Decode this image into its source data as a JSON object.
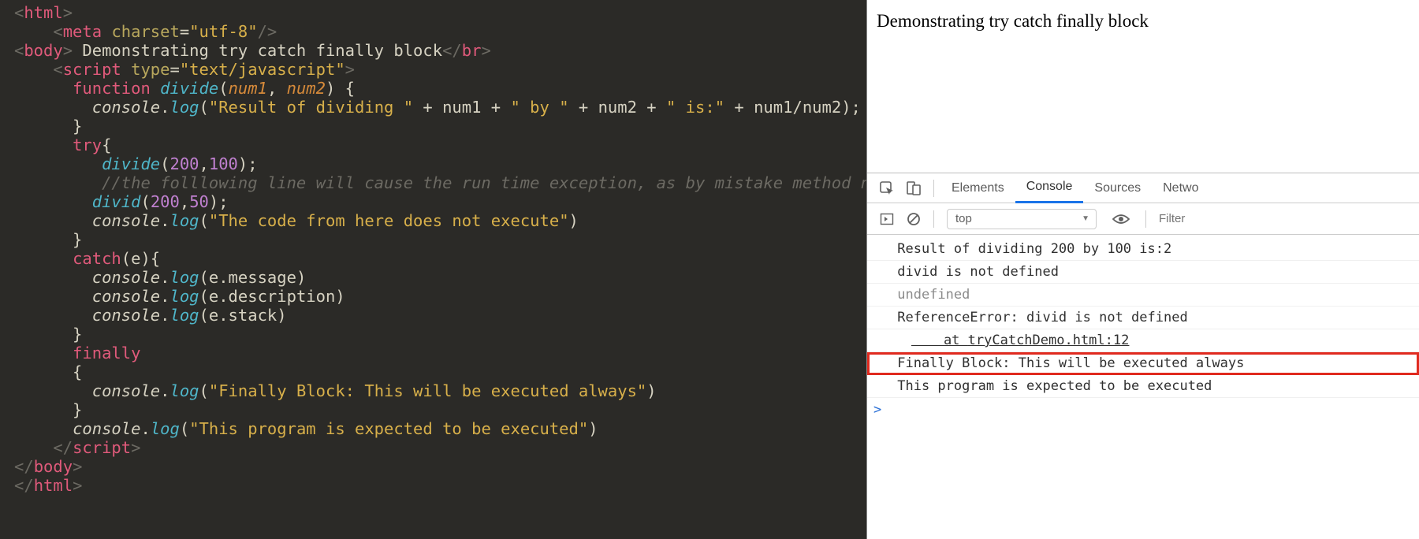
{
  "page": {
    "body_text": "Demonstrating try catch finally block"
  },
  "code": {
    "lines": [
      [
        {
          "t": "sl",
          "v": "<"
        },
        {
          "t": "tag",
          "v": "html"
        },
        {
          "t": "sl",
          "v": ">"
        }
      ],
      [
        {
          "t": "pun",
          "v": "    "
        },
        {
          "t": "sl",
          "v": "<"
        },
        {
          "t": "tag",
          "v": "meta"
        },
        {
          "t": "pun",
          "v": " "
        },
        {
          "t": "attr",
          "v": "charset"
        },
        {
          "t": "pun",
          "v": "="
        },
        {
          "t": "val",
          "v": "\"utf-8\""
        },
        {
          "t": "sl",
          "v": "/>"
        }
      ],
      [
        {
          "t": "sl",
          "v": "<"
        },
        {
          "t": "tag",
          "v": "body"
        },
        {
          "t": "sl",
          "v": "> "
        },
        {
          "t": "txt",
          "v": "Demonstrating try catch finally block"
        },
        {
          "t": "sl",
          "v": "</"
        },
        {
          "t": "tag",
          "v": "br"
        },
        {
          "t": "sl",
          "v": ">"
        }
      ],
      [
        {
          "t": "pun",
          "v": "    "
        },
        {
          "t": "sl",
          "v": "<"
        },
        {
          "t": "tag",
          "v": "script"
        },
        {
          "t": "pun",
          "v": " "
        },
        {
          "t": "attr",
          "v": "type"
        },
        {
          "t": "pun",
          "v": "="
        },
        {
          "t": "val",
          "v": "\"text/javascript\""
        },
        {
          "t": "sl",
          "v": ">"
        }
      ],
      [
        {
          "t": "pun",
          "v": "      "
        },
        {
          "t": "kw",
          "v": "function"
        },
        {
          "t": "pun",
          "v": " "
        },
        {
          "t": "fn",
          "v": "divide"
        },
        {
          "t": "pun",
          "v": "("
        },
        {
          "t": "param",
          "v": "num1"
        },
        {
          "t": "pun",
          "v": ", "
        },
        {
          "t": "param",
          "v": "num2"
        },
        {
          "t": "pun",
          "v": ") {"
        }
      ],
      [
        {
          "t": "pun",
          "v": "        "
        },
        {
          "t": "obj",
          "v": "console"
        },
        {
          "t": "pun",
          "v": "."
        },
        {
          "t": "meth",
          "v": "log"
        },
        {
          "t": "pun",
          "v": "("
        },
        {
          "t": "str",
          "v": "\"Result of dividing \""
        },
        {
          "t": "pun",
          "v": " + "
        },
        {
          "t": "txt",
          "v": "num1"
        },
        {
          "t": "pun",
          "v": " + "
        },
        {
          "t": "str",
          "v": "\" by \""
        },
        {
          "t": "pun",
          "v": " + "
        },
        {
          "t": "txt",
          "v": "num2"
        },
        {
          "t": "pun",
          "v": " + "
        },
        {
          "t": "str",
          "v": "\" is:\""
        },
        {
          "t": "pun",
          "v": " + "
        },
        {
          "t": "txt",
          "v": "num1"
        },
        {
          "t": "pun",
          "v": "/"
        },
        {
          "t": "txt",
          "v": "num2"
        },
        {
          "t": "pun",
          "v": ");"
        }
      ],
      [
        {
          "t": "pun",
          "v": "      }"
        }
      ],
      [
        {
          "t": "pun",
          "v": ""
        }
      ],
      [
        {
          "t": "pun",
          "v": "      "
        },
        {
          "t": "kw",
          "v": "try"
        },
        {
          "t": "pun",
          "v": "{"
        }
      ],
      [
        {
          "t": "pun",
          "v": "         "
        },
        {
          "t": "fn",
          "v": "divide"
        },
        {
          "t": "pun",
          "v": "("
        },
        {
          "t": "num",
          "v": "200"
        },
        {
          "t": "pun",
          "v": ","
        },
        {
          "t": "num",
          "v": "100"
        },
        {
          "t": "pun",
          "v": ");"
        }
      ],
      [
        {
          "t": "pun",
          "v": "         "
        },
        {
          "t": "cmt",
          "v": "//the folllowing line will cause the run time exception, as by mistake method name is wrong"
        }
      ],
      [
        {
          "t": "pun",
          "v": "        "
        },
        {
          "t": "fn",
          "v": "divid"
        },
        {
          "t": "pun",
          "v": "("
        },
        {
          "t": "num",
          "v": "200"
        },
        {
          "t": "pun",
          "v": ","
        },
        {
          "t": "num",
          "v": "50"
        },
        {
          "t": "pun",
          "v": ");"
        }
      ],
      [
        {
          "t": "pun",
          "v": "        "
        },
        {
          "t": "obj",
          "v": "console"
        },
        {
          "t": "pun",
          "v": "."
        },
        {
          "t": "meth",
          "v": "log"
        },
        {
          "t": "pun",
          "v": "("
        },
        {
          "t": "str",
          "v": "\"The code from here does not execute\""
        },
        {
          "t": "pun",
          "v": ")"
        }
      ],
      [
        {
          "t": "pun",
          "v": "      }"
        }
      ],
      [
        {
          "t": "pun",
          "v": "      "
        },
        {
          "t": "kw",
          "v": "catch"
        },
        {
          "t": "pun",
          "v": "(e){"
        }
      ],
      [
        {
          "t": "pun",
          "v": "        "
        },
        {
          "t": "obj",
          "v": "console"
        },
        {
          "t": "pun",
          "v": "."
        },
        {
          "t": "meth",
          "v": "log"
        },
        {
          "t": "pun",
          "v": "(e.message)"
        }
      ],
      [
        {
          "t": "pun",
          "v": "        "
        },
        {
          "t": "obj",
          "v": "console"
        },
        {
          "t": "pun",
          "v": "."
        },
        {
          "t": "meth",
          "v": "log"
        },
        {
          "t": "pun",
          "v": "(e.description)"
        }
      ],
      [
        {
          "t": "pun",
          "v": "        "
        },
        {
          "t": "obj",
          "v": "console"
        },
        {
          "t": "pun",
          "v": "."
        },
        {
          "t": "meth",
          "v": "log"
        },
        {
          "t": "pun",
          "v": "(e.stack)"
        }
      ],
      [
        {
          "t": "pun",
          "v": "      }"
        }
      ],
      [
        {
          "t": "pun",
          "v": "      "
        },
        {
          "t": "kw",
          "v": "finally"
        }
      ],
      [
        {
          "t": "pun",
          "v": "      {"
        }
      ],
      [
        {
          "t": "pun",
          "v": "        "
        },
        {
          "t": "obj",
          "v": "console"
        },
        {
          "t": "pun",
          "v": "."
        },
        {
          "t": "meth",
          "v": "log"
        },
        {
          "t": "pun",
          "v": "("
        },
        {
          "t": "str",
          "v": "\"Finally Block: This will be executed always\""
        },
        {
          "t": "pun",
          "v": ")"
        }
      ],
      [
        {
          "t": "pun",
          "v": "      }"
        }
      ],
      [
        {
          "t": "pun",
          "v": "      "
        },
        {
          "t": "obj",
          "v": "console"
        },
        {
          "t": "pun",
          "v": "."
        },
        {
          "t": "meth",
          "v": "log"
        },
        {
          "t": "pun",
          "v": "("
        },
        {
          "t": "str",
          "v": "\"This program is expected to be executed\""
        },
        {
          "t": "pun",
          "v": ")"
        }
      ],
      [
        {
          "t": "pun",
          "v": "    "
        },
        {
          "t": "sl",
          "v": "</"
        },
        {
          "t": "tag",
          "v": "script"
        },
        {
          "t": "sl",
          "v": ">"
        }
      ],
      [
        {
          "t": "sl",
          "v": "</"
        },
        {
          "t": "tag",
          "v": "body"
        },
        {
          "t": "sl",
          "v": ">"
        }
      ],
      [
        {
          "t": "sl",
          "v": "</"
        },
        {
          "t": "tag",
          "v": "html"
        },
        {
          "t": "sl",
          "v": ">"
        }
      ]
    ]
  },
  "devtools": {
    "tabs": {
      "elements": "Elements",
      "console": "Console",
      "sources": "Sources",
      "network": "Netwo"
    },
    "context": "top",
    "filter_placeholder": "Filter",
    "console": {
      "lines": [
        {
          "text": " Result of dividing 200 by 100 is:2",
          "class": ""
        },
        {
          "text": " divid is not defined",
          "class": ""
        },
        {
          "text": " undefined",
          "class": "dim"
        },
        {
          "text": " ReferenceError: divid is not defined",
          "class": ""
        },
        {
          "text": "at tryCatchDemo.html:12",
          "class": "stack link",
          "link_text": "tryCatchDemo.html:12"
        },
        {
          "text": " Finally Block: This will be executed always",
          "class": "highlight"
        },
        {
          "text": " This program is expected to be executed",
          "class": ""
        }
      ],
      "prompt": ">"
    }
  }
}
